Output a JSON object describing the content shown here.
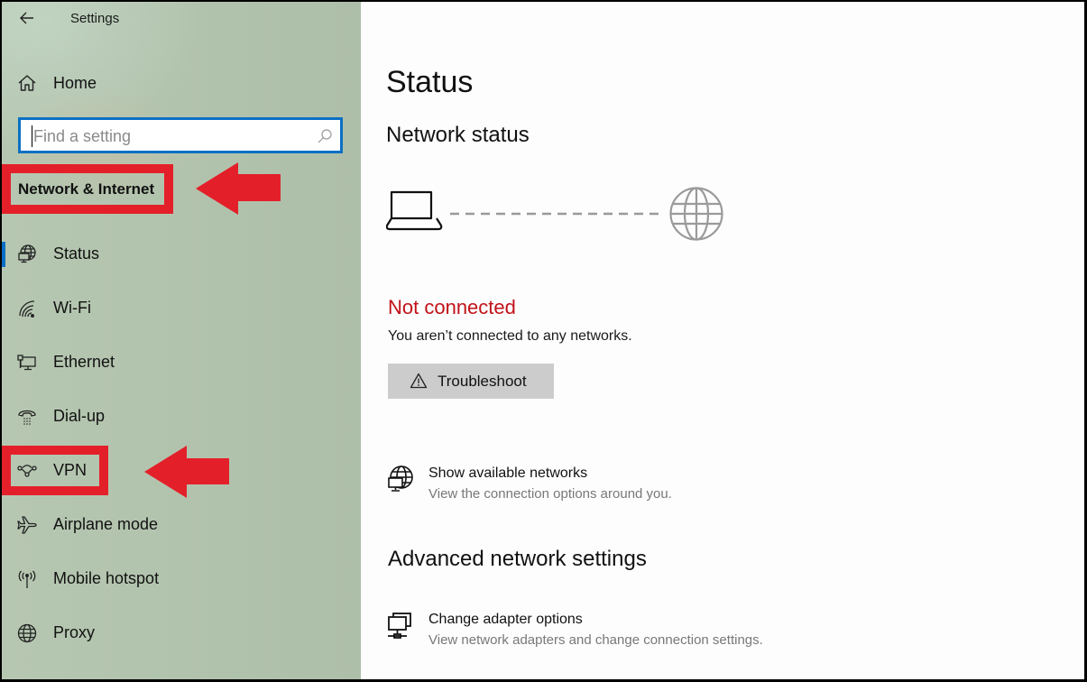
{
  "window": {
    "title": "Settings",
    "back_icon": "back-arrow-icon"
  },
  "sidebar": {
    "home": {
      "label": "Home",
      "icon": "home-icon"
    },
    "search": {
      "placeholder": "Find a setting",
      "value": "",
      "icon": "search-icon"
    },
    "section_title": "Network & Internet",
    "items": [
      {
        "label": "Status",
        "icon": "status-globe-monitor-icon",
        "selected": true
      },
      {
        "label": "Wi-Fi",
        "icon": "wifi-icon",
        "selected": false
      },
      {
        "label": "Ethernet",
        "icon": "ethernet-icon",
        "selected": false
      },
      {
        "label": "Dial-up",
        "icon": "dialup-phone-icon",
        "selected": false
      },
      {
        "label": "VPN",
        "icon": "vpn-icon",
        "selected": false
      },
      {
        "label": "Airplane mode",
        "icon": "airplane-icon",
        "selected": false
      },
      {
        "label": "Mobile hotspot",
        "icon": "hotspot-icon",
        "selected": false
      },
      {
        "label": "Proxy",
        "icon": "globe-icon",
        "selected": false
      }
    ],
    "accent_color": "#0b6fc6"
  },
  "annotations": {
    "highlight_color": "#e3202a",
    "highlighted": [
      "Network & Internet",
      "VPN"
    ]
  },
  "main": {
    "title": "Status",
    "network_status": {
      "heading": "Network status",
      "diagram": {
        "left_icon": "laptop-icon",
        "right_icon": "internet-globe-icon",
        "connection": "disconnected-dashed-line"
      },
      "state": "Not connected",
      "state_color": "#c1121a",
      "description": "You aren’t connected to any networks.",
      "troubleshoot_label": "Troubleshoot",
      "troubleshoot_icon": "warning-icon"
    },
    "show_networks": {
      "title": "Show available networks",
      "description": "View the connection options around you.",
      "icon": "globe-monitor-icon"
    },
    "advanced": {
      "heading": "Advanced network settings",
      "items": [
        {
          "title": "Change adapter options",
          "description": "View network adapters and change connection settings.",
          "icon": "network-adapter-icon"
        }
      ]
    }
  }
}
